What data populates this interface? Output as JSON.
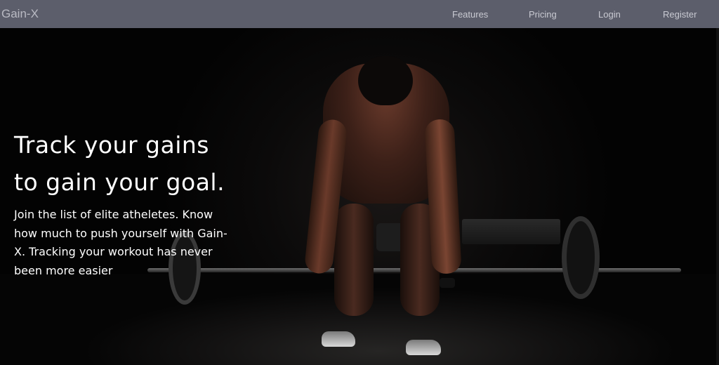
{
  "navbar": {
    "brand": "Gain-X",
    "links": {
      "features": "Features",
      "pricing": "Pricing",
      "login": "Login",
      "register": "Register"
    }
  },
  "hero": {
    "heading_line1": "Track your gains",
    "heading_line2": "to gain your goal.",
    "subtext": "Join the list of elite atheletes. Know how much to push yourself with Gain-X. Tracking your workout has never been more easier"
  },
  "colors": {
    "navbar_bg": "#5c5e6b",
    "nav_text": "#c9cad2",
    "hero_text": "#ffffff"
  }
}
